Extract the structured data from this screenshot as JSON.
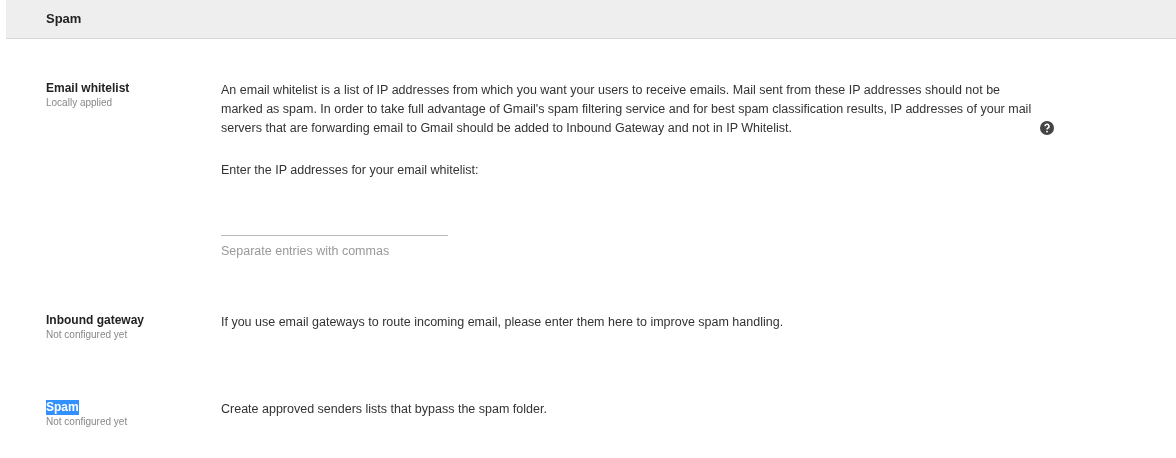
{
  "header": {
    "title": "Spam"
  },
  "settings": [
    {
      "label": "Email whitelist",
      "status": "Locally applied",
      "highlighted": false,
      "description": "An email whitelist is a list of IP addresses from which you want your users to receive emails. Mail sent from these IP addresses should not be marked as spam. In order to take full advantage of Gmail's spam filtering service and for best spam classification results, IP addresses of your mail servers that are forwarding email to Gmail should be added to Inbound Gateway and not in IP Whitelist.",
      "help": true,
      "prompt": "Enter the IP addresses for your email whitelist:",
      "field": {
        "hint": "Separate entries with commas"
      }
    },
    {
      "label": "Inbound gateway",
      "status": "Not configured yet",
      "highlighted": false,
      "description": "If you use email gateways to route incoming email, please enter them here to improve spam handling.",
      "help": false
    },
    {
      "label": "Spam",
      "status": "Not configured yet",
      "highlighted": true,
      "description": "Create approved senders lists that bypass the spam folder.",
      "help": false
    }
  ]
}
